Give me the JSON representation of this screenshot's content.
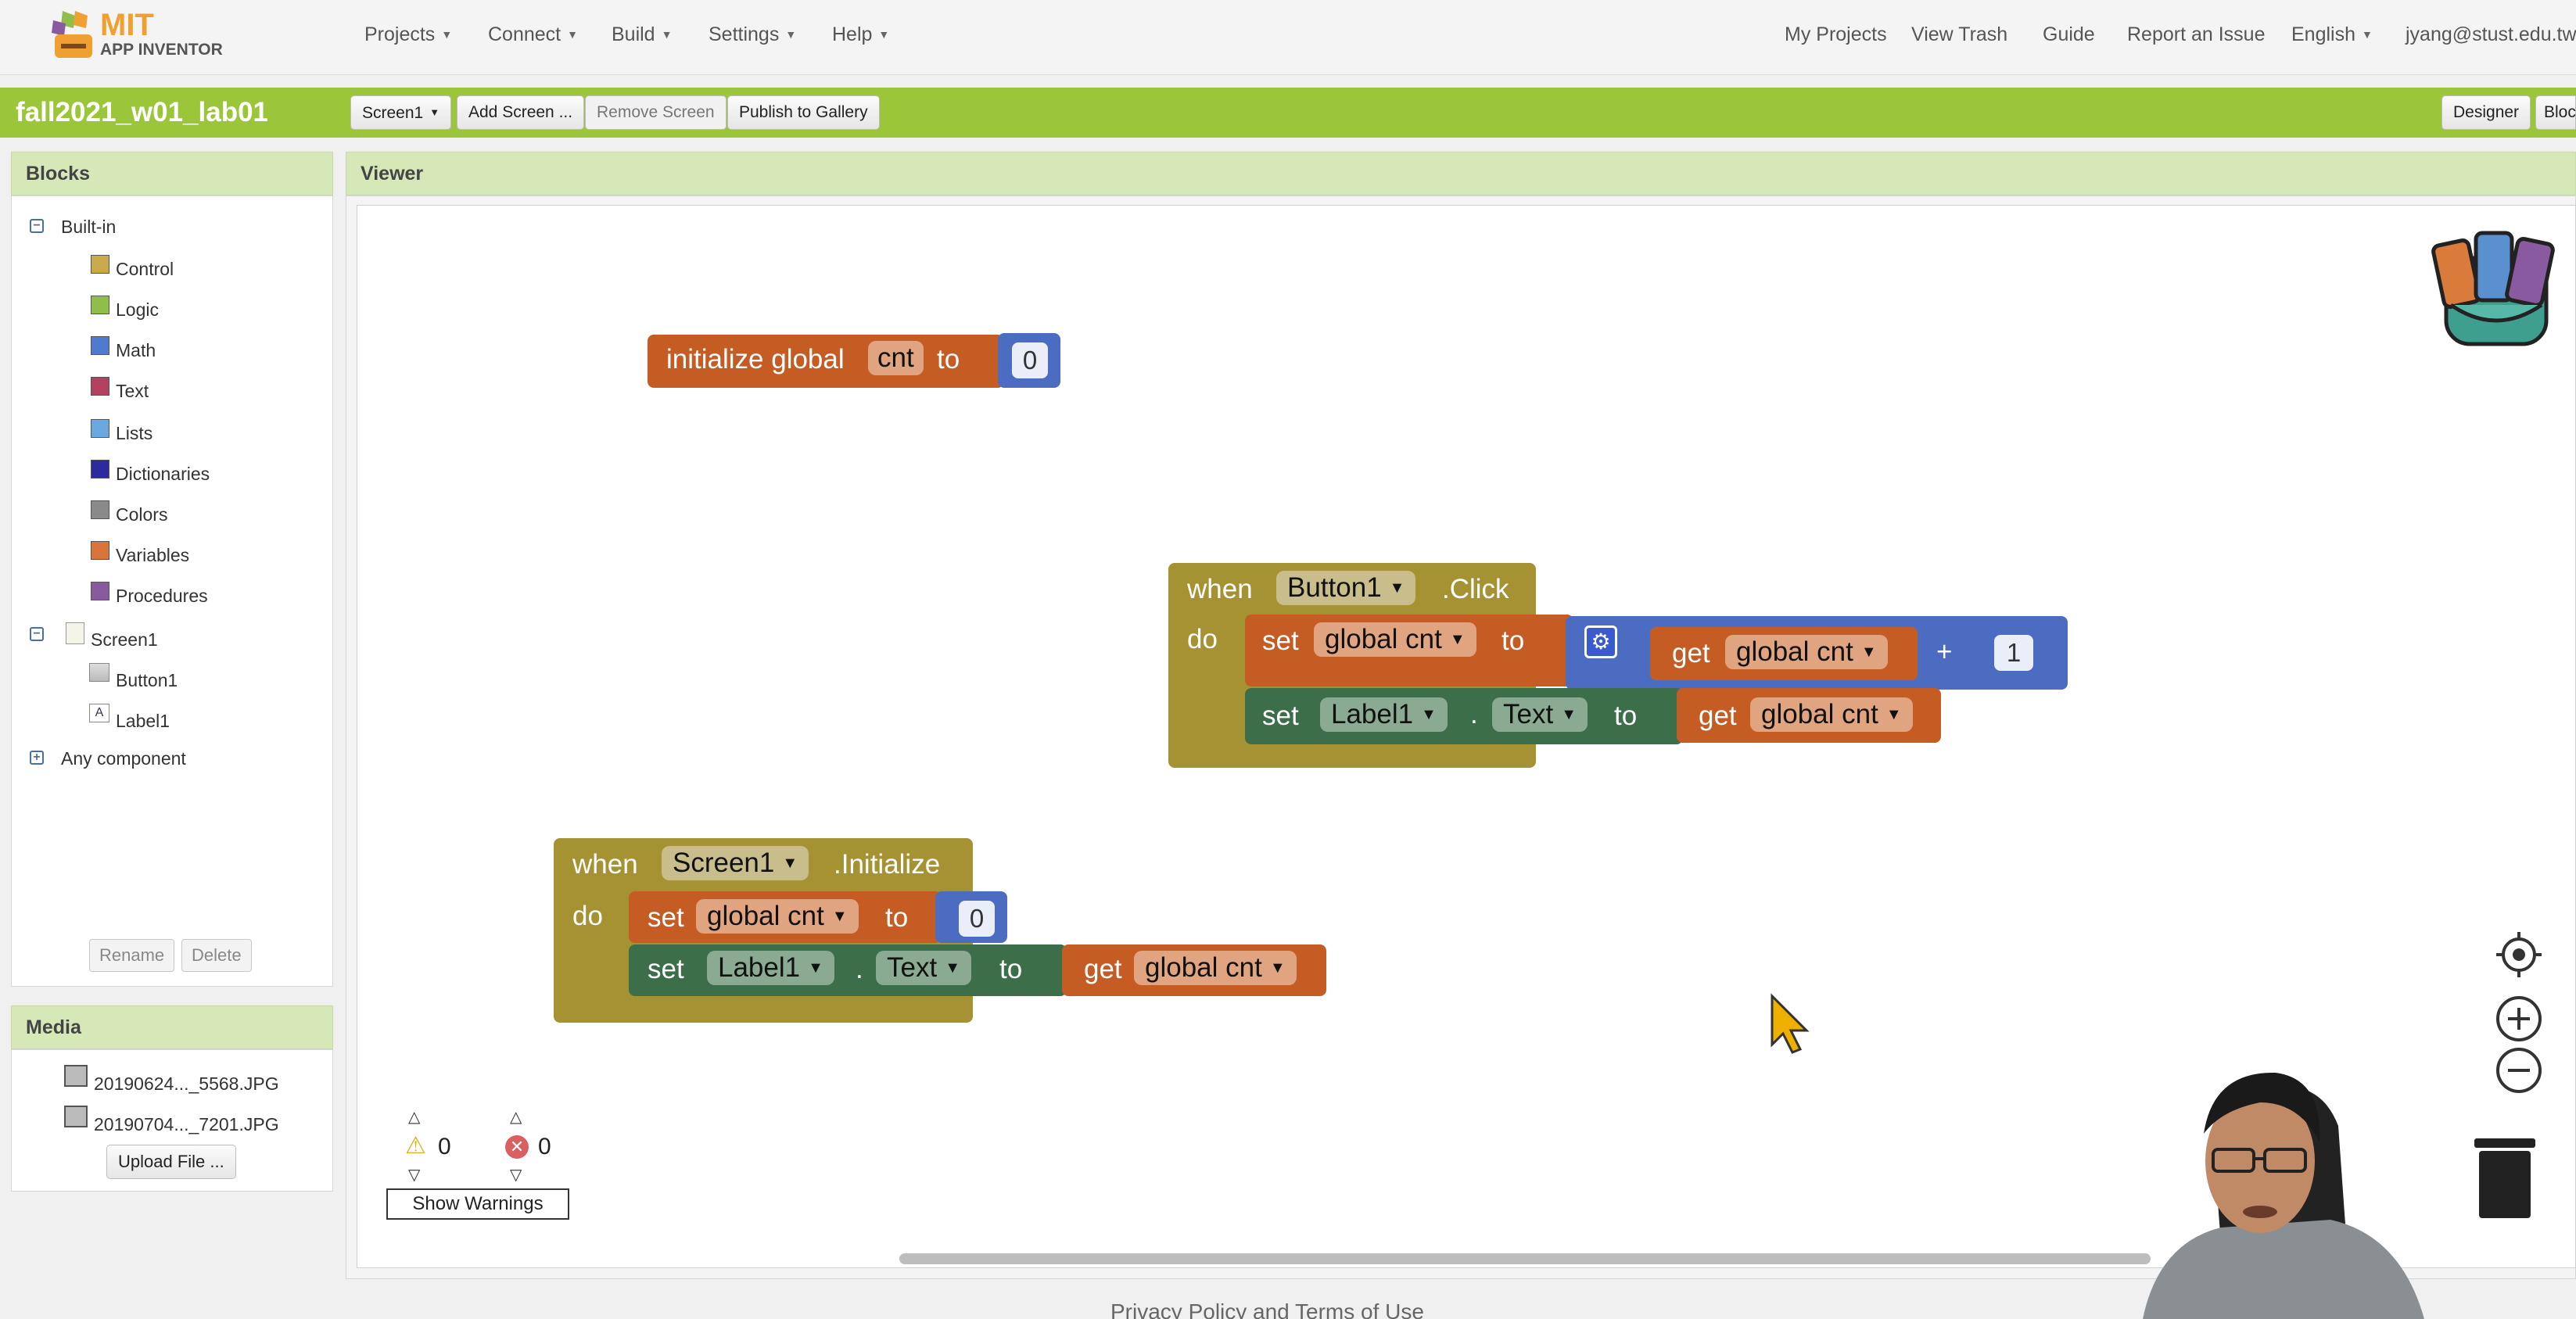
{
  "app": {
    "logo_main": "MIT",
    "logo_sub": "APP INVENTOR"
  },
  "nav": {
    "left": [
      {
        "label": "Projects"
      },
      {
        "label": "Connect"
      },
      {
        "label": "Build"
      },
      {
        "label": "Settings"
      },
      {
        "label": "Help"
      }
    ],
    "right": {
      "my_projects": "My Projects",
      "view_trash": "View Trash",
      "guide": "Guide",
      "report": "Report an Issue",
      "language": "English",
      "user": "jyang@stust.edu.tw"
    }
  },
  "project": {
    "name": "fall2021_w01_lab01",
    "screen_select": "Screen1",
    "add_screen": "Add Screen ...",
    "remove_screen": "Remove Screen",
    "publish": "Publish to Gallery",
    "designer": "Designer",
    "blocks": "Bloc"
  },
  "blocks_panel": {
    "title": "Blocks",
    "builtin_label": "Built-in",
    "builtin": [
      {
        "label": "Control",
        "color": "#c9a94a"
      },
      {
        "label": "Logic",
        "color": "#8fbf4a"
      },
      {
        "label": "Math",
        "color": "#4f7ad0"
      },
      {
        "label": "Text",
        "color": "#b3415f"
      },
      {
        "label": "Lists",
        "color": "#6aa8e0"
      },
      {
        "label": "Dictionaries",
        "color": "#2d2aa0"
      },
      {
        "label": "Colors",
        "color": "#8a8a8a"
      },
      {
        "label": "Variables",
        "color": "#d9743a"
      },
      {
        "label": "Procedures",
        "color": "#8a5aa0"
      }
    ],
    "screen_label": "Screen1",
    "components": [
      {
        "label": "Button1"
      },
      {
        "label": "Label1"
      }
    ],
    "any_component": "Any component",
    "rename": "Rename",
    "delete": "Delete"
  },
  "media_panel": {
    "title": "Media",
    "files": [
      "20190624..._5568.JPG",
      "20190704..._7201.JPG"
    ],
    "upload": "Upload File ..."
  },
  "viewer": {
    "title": "Viewer",
    "warnings_count": "0",
    "errors_count": "0",
    "show_warnings": "Show Warnings",
    "footer": "Privacy Policy and Terms of Use"
  },
  "blocks_code": {
    "init": {
      "label": "initialize global",
      "var": "cnt",
      "to": "to",
      "value": "0"
    },
    "click": {
      "when": "when",
      "component": "Button1",
      "event": ".Click",
      "do": "do",
      "set1": "set",
      "set1_var": "global cnt",
      "to": "to",
      "get": "get",
      "get_var": "global cnt",
      "plus": "+",
      "num": "1",
      "set2": "set",
      "set2_comp": "Label1",
      "dot": ".",
      "prop": "Text",
      "get2": "get",
      "get2_var": "global cnt"
    },
    "initialize": {
      "when": "when",
      "component": "Screen1",
      "event": ".Initialize",
      "do": "do",
      "set1": "set",
      "set1_var": "global cnt",
      "to": "to",
      "value": "0",
      "set2": "set",
      "set2_comp": "Label1",
      "dot": ".",
      "prop": "Text",
      "get": "get",
      "get_var": "global cnt"
    }
  },
  "colors": {
    "accent": "#9cc63a",
    "control_block": "#a59233",
    "variable_block": "#c45c24",
    "math_block": "#4c6cc2",
    "component_block": "#3c6e4a"
  }
}
